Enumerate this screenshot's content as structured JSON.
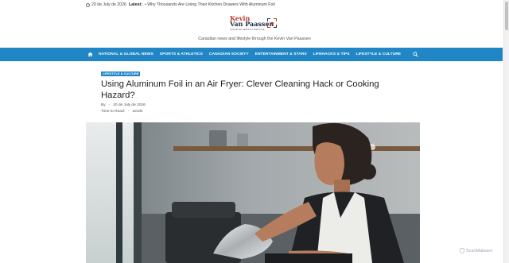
{
  "topbar": {
    "date": "20 de July de 2026",
    "latest_label": "Latest:",
    "latest_headline": "• Why Thousands Are Lining Their Kitchen Drawers With Aluminum Foil"
  },
  "logo": {
    "line1": "Kevin",
    "line2": "Van Paassen",
    "line3": "CANADIAN NEWS & LIFESTYLE"
  },
  "tagline": "Canadian news and lifestyle through the Kevin Van Paassen",
  "nav": {
    "items": [
      "NATIONAL & GLOBAL NEWS",
      "SPORTS & ATHLETICS",
      "CANADIAN SOCIETY",
      "ENTERTAINMENT & STARS",
      "LIFEHACKS & TIPS",
      "LIFESTYLE & CULTURE"
    ]
  },
  "article": {
    "category": "LIFESTYLE & CULTURE",
    "title": "Using Aluminum Foil in an Air Fryer: Clever Cleaning Hack or Cooking Hazard?",
    "by_label": "By",
    "author": "-",
    "date": "20 de July de 2026",
    "time_to_read_label": "Time to Read:",
    "time_value": "-",
    "words_label": "words"
  },
  "watermark": "ScanMalware",
  "colors": {
    "nav_bg": "#2086c6",
    "logo_red": "#c0392b",
    "logo_navy": "#1b2b48"
  }
}
